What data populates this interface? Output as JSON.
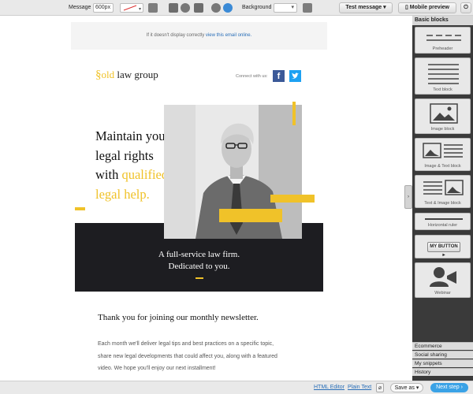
{
  "toolbar": {
    "message_label": "Message",
    "width_value": "600px",
    "background_label": "Background",
    "test_message_label": "Test message ▾",
    "mobile_preview_label": "Mobile preview"
  },
  "email": {
    "preheader_text": "If it doesn't display correctly",
    "preheader_link": "view this email online.",
    "logo_s": "§",
    "logo_old": "old",
    "logo_rest": "law group",
    "connect_text": "Connect with us:",
    "facebook_glyph": "f",
    "hero_line1": "Maintain your",
    "hero_line2": "legal rights",
    "hero_line3_a": "with ",
    "hero_line3_b": "qualified",
    "hero_line4": "legal help.",
    "tagline_1": "A full-service law firm.",
    "tagline_2": "Dedicated to you.",
    "thanks": "Thank you for joining our monthly newsletter.",
    "body_1": "Each month we'll deliver legal tips and best practices on a specific topic,",
    "body_2": "share new legal developments that could affect you, along with a featured",
    "body_3": "video. We hope you'll enjoy our next installment!"
  },
  "panel": {
    "header": "Basic blocks",
    "blocks": [
      {
        "label": "Preheader"
      },
      {
        "label": "Text block"
      },
      {
        "label": "Image block"
      },
      {
        "label": "Image & Text block"
      },
      {
        "label": "Text & Image block"
      },
      {
        "label": "Horizontal ruler"
      },
      {
        "label": "MY BUTTON ▸"
      },
      {
        "label": "Webinar"
      }
    ],
    "sections": [
      "Ecommerce",
      "Social sharing",
      "My snippets",
      "History"
    ]
  },
  "bottom": {
    "html_editor": "HTML Editor",
    "plain_text": "Plain Text",
    "save_as": "Save as ▾",
    "next_step": "Next step ›"
  },
  "colors": {
    "accent": "#f0c229",
    "dark": "#1d1d21",
    "link": "#2a6fb8",
    "next_btn": "#3aa2e6"
  }
}
